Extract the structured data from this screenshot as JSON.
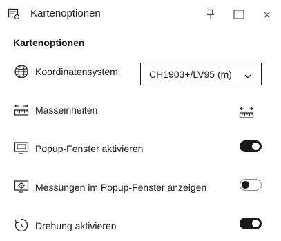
{
  "window": {
    "title": "Kartenoptionen",
    "title_icon": "map-options-icon",
    "buttons": [
      "pin-icon",
      "maximize-icon",
      "close-icon"
    ]
  },
  "section": {
    "title": "Kartenoptionen"
  },
  "options": {
    "coordinate_system": {
      "label": "Koordinatensystem",
      "icon": "globe-icon",
      "selected_value": "CH1903+/LV95 (m)"
    },
    "units": {
      "label": "Masseinheiten",
      "icon": "ruler-icon",
      "control_icon": "ruler-icon"
    },
    "popup": {
      "label": "Popup-Fenster aktivieren",
      "icon": "popup-window-icon",
      "enabled": true
    },
    "measurements_popup": {
      "label": "Messungen im Popup-Fenster anzeigen",
      "icon": "measure-settings-icon",
      "enabled": false
    },
    "rotation": {
      "label": "Drehung aktivieren",
      "icon": "rotate-icon",
      "enabled": true
    }
  },
  "colors": {
    "text": "#1a1a1a",
    "toggle_on": "#1a1a1a",
    "toggle_off_border": "#8a8a8a",
    "background": "#ffffff"
  }
}
